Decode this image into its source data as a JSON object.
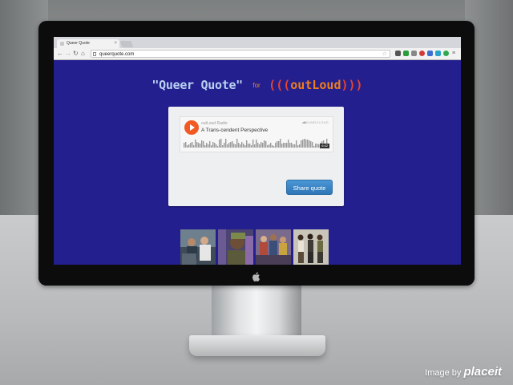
{
  "browser": {
    "tab_title": "Queer Quote",
    "tab_close_icon": "close-icon",
    "url": "queerquote.com",
    "back_icon": "back-arrow-icon",
    "forward_icon": "forward-arrow-icon",
    "reload_icon": "reload-icon",
    "home_icon": "home-icon",
    "bookmark_icon": "star-icon"
  },
  "page": {
    "title": "\"Queer Quote\"",
    "for_text": "for",
    "brand_name": "outLoud",
    "background_color": "#231f8f"
  },
  "player": {
    "user": "outLoud Radio",
    "track": "A Trans-cendent Perspective",
    "service_logo": "SOUNDCLOUD",
    "duration": "6:42",
    "play_icon": "play-icon"
  },
  "share_button": {
    "label": "Share quote",
    "color": "#3a86c6"
  },
  "thumbnails": [
    {
      "name": "thumbnail-1"
    },
    {
      "name": "thumbnail-2"
    },
    {
      "name": "thumbnail-3"
    },
    {
      "name": "thumbnail-4"
    }
  ],
  "watermark": {
    "prefix": "Image by",
    "brand": "placeit"
  }
}
